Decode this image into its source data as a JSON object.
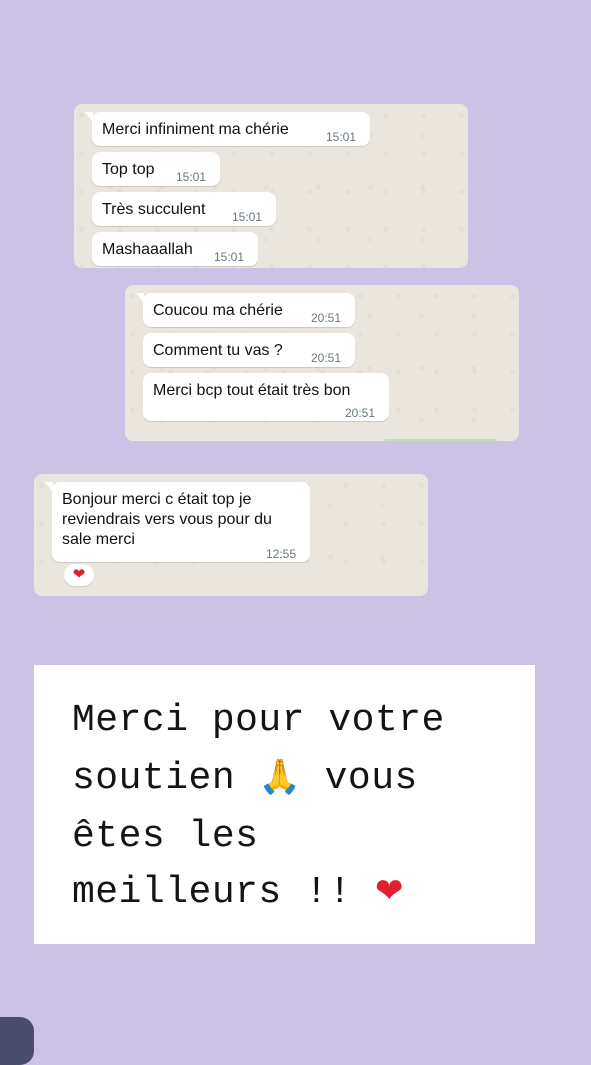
{
  "chat1": {
    "messages": [
      {
        "text": "Merci infiniment ma chérie",
        "time": "15:01"
      },
      {
        "text": "Top top",
        "time": "15:01"
      },
      {
        "text": "Très succulent",
        "time": "15:01"
      },
      {
        "text": "Mashaaallah",
        "time": "15:01"
      }
    ]
  },
  "chat2": {
    "messages": [
      {
        "text": "Coucou ma chérie",
        "time": "20:51"
      },
      {
        "text": "Comment tu vas ?",
        "time": "20:51"
      },
      {
        "text": "Merci bcp tout était très bon",
        "time": "20:51"
      }
    ]
  },
  "chat3": {
    "message": {
      "line1": "Bonjour merci c était top je",
      "line2": "reviendrais vers vous pour du",
      "line3": "sale merci",
      "time": "12:55"
    },
    "reaction": "❤"
  },
  "note": {
    "line1": "Merci pour votre",
    "line2_a": "soutien",
    "line2_emoji": "🙏",
    "line2_b": "vous",
    "line3": "êtes les",
    "line4": "meilleurs !!",
    "line4_emoji": "❤"
  },
  "colors": {
    "background": "#cbc2e6",
    "chat_wallpaper": "#ebe6dd",
    "bubble": "#ffffff",
    "timestamp": "#667781",
    "heart": "#e0202c"
  },
  "icons": [
    "heart-reaction-icon",
    "praying-hands-icon",
    "heart-icon"
  ]
}
